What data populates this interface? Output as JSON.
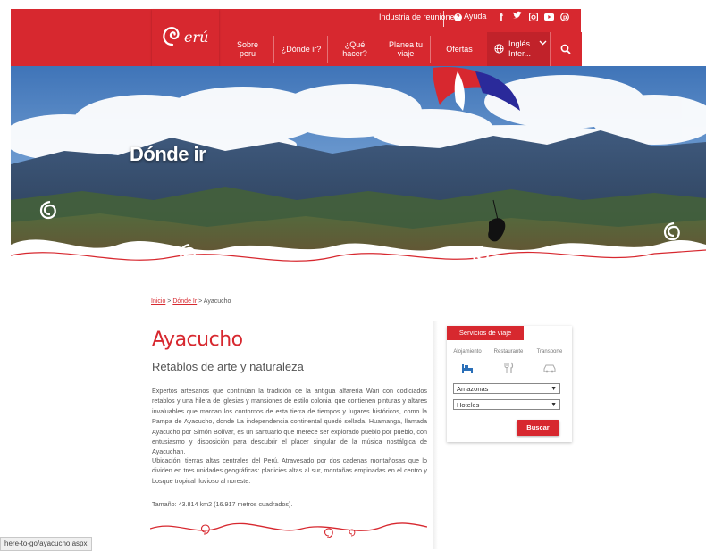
{
  "header": {
    "logo_text": "erú",
    "util_links": {
      "meetings": "Industria de reuniones",
      "help": "Ayuda"
    },
    "social": [
      {
        "icon": "facebook-icon",
        "glyph": "f"
      },
      {
        "icon": "twitter-icon",
        "glyph": "🐦"
      },
      {
        "icon": "instagram-icon",
        "glyph": "◙"
      },
      {
        "icon": "youtube-icon",
        "glyph": "▶"
      },
      {
        "icon": "pinterest-icon",
        "glyph": "℗"
      }
    ],
    "nav": [
      {
        "label": "Sobre peru"
      },
      {
        "label": "¿Dónde ir?"
      },
      {
        "label": "¿Qué hacer?"
      },
      {
        "label": "Planea tu viaje"
      },
      {
        "label": "Ofertas"
      }
    ],
    "language": "Inglés Inter...",
    "accent_color": "#d7282f"
  },
  "hero": {
    "title": "Dónde ir"
  },
  "breadcrumb": {
    "home": "Inicio",
    "sep1": " > ",
    "where": "Dónde Ir",
    "sep2": " > ",
    "current": "Ayacucho"
  },
  "main": {
    "title": "Ayacucho",
    "subtitle": "Retablos de arte y naturaleza",
    "paragraph1": "Expertos artesanos que continúan la tradición de la antigua alfarería Wari con codiciados retablos y una hilera de iglesias y mansiones de estilo colonial que contienen pinturas y altares invaluables que marcan los contornos de esta tierra de tiempos y lugares históricos, como la Pampa de Ayacucho, donde La independencia continental quedó sellada. Huamanga, llamada Ayacucho por Simón Bolívar, es un santuario que merece ser explorado pueblo por pueblo, con entusiasmo y disposición para descubrir el placer singular de la música nostálgica de Ayacuchan.",
    "paragraph2": "Ubicación: tierras altas centrales del Perú. Atravesado por dos cadenas montañosas que lo dividen en tres unidades geográficas: planicies altas al sur, montañas empinadas en el centro y bosque tropical lluvioso al noreste.",
    "paragraph3": "Tamaño: 43.814 km2 (16.917 metros cuadrados)."
  },
  "services": {
    "title": "Servicios de viaje",
    "tabs": [
      {
        "label": "Alojamiento",
        "icon": "bed-icon"
      },
      {
        "label": "Restaurante",
        "icon": "fork-knife-icon"
      },
      {
        "label": "Transporte",
        "icon": "car-icon"
      }
    ],
    "region_select": "Amazonas",
    "type_select": "Hoteles",
    "search_button": "Buscar"
  },
  "status_bar": {
    "url": "here-to-go/ayacucho.aspx"
  }
}
